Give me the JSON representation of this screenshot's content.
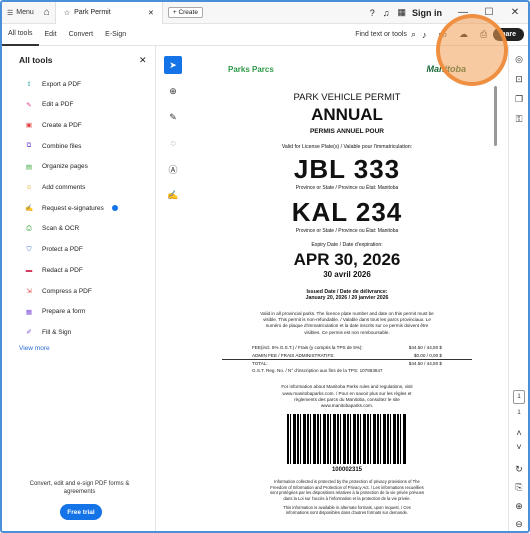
{
  "titlebar": {
    "menu_label": "Menu",
    "tab_title": "Park Permit",
    "create_label": "Create",
    "signin_label": "Sign in"
  },
  "toolbar": {
    "tabs": [
      "All tools",
      "Edit",
      "Convert",
      "E-Sign"
    ],
    "find_label": "Find text or tools",
    "share_label": "hare"
  },
  "sidebar": {
    "title": "All tools",
    "tools": [
      {
        "label": "Export a PDF",
        "icon": "export-pdf-icon",
        "color": "#1c9c9c"
      },
      {
        "label": "Edit a PDF",
        "icon": "edit-pdf-icon",
        "color": "#d23a8c"
      },
      {
        "label": "Create a PDF",
        "icon": "create-pdf-icon",
        "color": "#e03a3a"
      },
      {
        "label": "Combine files",
        "icon": "combine-files-icon",
        "color": "#7b4fd6"
      },
      {
        "label": "Organize pages",
        "icon": "organize-pages-icon",
        "color": "#39a33a"
      },
      {
        "label": "Add comments",
        "icon": "add-comments-icon",
        "color": "#e0a010"
      },
      {
        "label": "Request e-signatures",
        "icon": "request-esign-icon",
        "color": "#7b4fd6"
      },
      {
        "label": "Scan & OCR",
        "icon": "scan-ocr-icon",
        "color": "#39a33a"
      },
      {
        "label": "Protect a PDF",
        "icon": "protect-pdf-icon",
        "color": "#3a6fd6"
      },
      {
        "label": "Redact a PDF",
        "icon": "redact-pdf-icon",
        "color": "#d23a5c"
      },
      {
        "label": "Compress a PDF",
        "icon": "compress-pdf-icon",
        "color": "#e03a3a"
      },
      {
        "label": "Prepare a form",
        "icon": "prepare-form-icon",
        "color": "#7b4fd6"
      },
      {
        "label": "Fill & Sign",
        "icon": "fill-sign-icon",
        "color": "#7b4fd6"
      }
    ],
    "view_more": "View more",
    "promo_text": "Convert, edit and e-sign PDF forms & agreements",
    "trial_label": "Free trial"
  },
  "document": {
    "parks_logo": "Parks Parcs",
    "manitoba_logo": "Manitoba",
    "heading1": "PARK VEHICLE PERMIT",
    "heading2": "ANNUAL",
    "heading3": "PERMIS ANNUEL POUR",
    "valid_for": "Valid for License Plate(s) / Valable pour l'immatriculation:",
    "plate1": "JBL 333",
    "plate1_prov": "Province or State / Province ou État: Manitoba",
    "plate2": "KAL 234",
    "plate2_prov": "Province or State / Province ou État: Manitoba",
    "expiry_label": "Expiry Date / Date d'expiration:",
    "expiry_date": "APR 30, 2026",
    "expiry_fr": "30 avril 2026",
    "issued_label": "Issued Date / Date de délivrance:",
    "issued_date": "January 20, 2026 / 20 janvier 2026",
    "validity_note": "Valid in all provincial parks. The licence plate number and date on this permit must be visible. This permit is non-refundable. / Valable dans tous les parcs provinciaux. Le numéro de plaque d'immatriculation et la date inscrits sur ce permis doivent être visibles. Ce permis est non remboursable.",
    "fee_label": "FEE(incl. 5% G.S.T.) / Frais (y compris la TPS de 5%):",
    "fee_value": "$44.50 / 44,50 $",
    "admin_label": "ADMIN FEE / FRAIS ADMINISTRATIFS:",
    "admin_value": "$0.00 / 0,00 $",
    "total_label": "TOTAL:",
    "total_value": "$44.50 / 44,50 $",
    "gst_line": "G.S.T. Reg. No. / N° d'inscription aux fins de la TPS: 107863847",
    "info_text": "For information about Manitoba Parks rules and regulations, visit www.manitobaparks.com. / Pour en savoir plus sur les règles et règlements des parcs du Manitoba, consultez le site www.manitobaparks.com.",
    "barcode_number": "100002315",
    "privacy_text": "Information collected is protected by the protection of privacy provisions of The Freedom of Information and Protection of Privacy Act. / Les informations recueillies sont protégées par les dispositions relatives à la protection de la vie privée prévues dans la Loi sur l'accès à l'information et la protection de la vie privée.",
    "alt_format": "This information is available in alternate formats, upon request. / Ces informations sont disponibles dans d'autres formats sur demande."
  },
  "pagination": {
    "current": "1",
    "total": "1"
  }
}
